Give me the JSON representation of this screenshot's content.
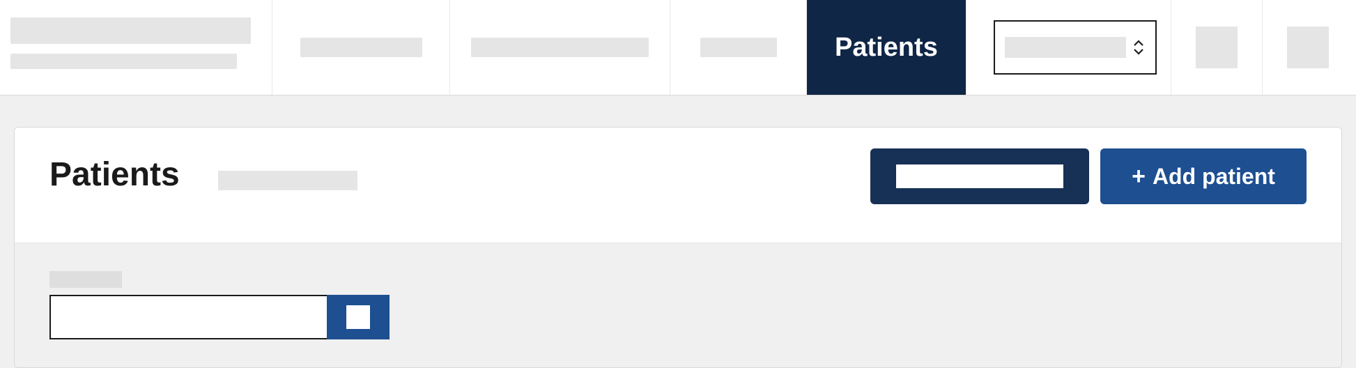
{
  "nav": {
    "active_tab_label": "Patients"
  },
  "page": {
    "title": "Patients",
    "add_patient_label": "Add patient"
  },
  "colors": {
    "nav_active_bg": "#0f2646",
    "primary_btn_bg": "#1d4f91",
    "dark_btn_bg": "#173055"
  }
}
